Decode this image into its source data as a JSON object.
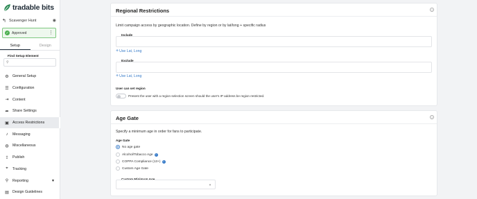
{
  "brand": {
    "name": "tradable bits",
    "color": "#2e8b57"
  },
  "campaign": {
    "name": "Scavenger Hunt",
    "back_icon": "back-arrow-icon",
    "visibility_icon": "eye-icon"
  },
  "status": {
    "label": "Approved",
    "color": "#4caf50",
    "menu_icon": "kebab-icon"
  },
  "tabs": [
    {
      "label": "Setup",
      "active": true
    },
    {
      "label": "Design",
      "active": false
    }
  ],
  "find": {
    "label": "Find Setup Element",
    "placeholder": "",
    "icon": "search-icon"
  },
  "nav": [
    {
      "label": "General Setup",
      "icon": "gear-icon"
    },
    {
      "label": "Configuration",
      "icon": "sliders-icon"
    },
    {
      "label": "Content",
      "icon": "content-icon"
    },
    {
      "label": "Share Settings",
      "icon": "share-icon"
    },
    {
      "label": "Access Restrictions",
      "icon": "lock-icon",
      "active": true
    },
    {
      "label": "Messaging",
      "icon": "bell-icon"
    },
    {
      "label": "Miscellaneous",
      "icon": "globe-icon"
    },
    {
      "label": "Publish",
      "icon": "publish-icon"
    },
    {
      "label": "Tracking",
      "icon": "tracking-icon"
    },
    {
      "label": "Reporting",
      "icon": "search-icon",
      "has_chevron": true
    },
    {
      "label": "Design Guidelines",
      "icon": "book-icon"
    }
  ],
  "regional": {
    "title": "Regional Restrictions",
    "description": "Limit campaign access by geographic location. Define by region or by lat/long + specific radius",
    "include_label": "Include",
    "include_link": "Use Lat, Long",
    "exclude_label": "Exclude",
    "exclude_link": "Use Lat, Long",
    "user_region_label": "User can set region",
    "user_region_text": "Present the user with a region selection screen should the user's IP address be region restricted.",
    "user_region_enabled": false
  },
  "age_gate": {
    "title": "Age Gate",
    "description": "Specify a minimum age in order for fans to participate.",
    "group_label": "Age Gate",
    "options": [
      {
        "label": "No age gate",
        "checked": true,
        "info": false
      },
      {
        "label": "Alcohol/Tobacco Age",
        "checked": false,
        "info": true
      },
      {
        "label": "COPPA Compliance (13+)",
        "checked": false,
        "info": true
      },
      {
        "label": "Custom Age Gate",
        "checked": false,
        "info": false
      }
    ],
    "custom_min_label": "Custom Minimum Age",
    "custom_min_value": ""
  },
  "colors": {
    "link": "#3a7dc9",
    "active_nav_bg": "#e9ebee",
    "page_bg": "#f2f3f5"
  }
}
